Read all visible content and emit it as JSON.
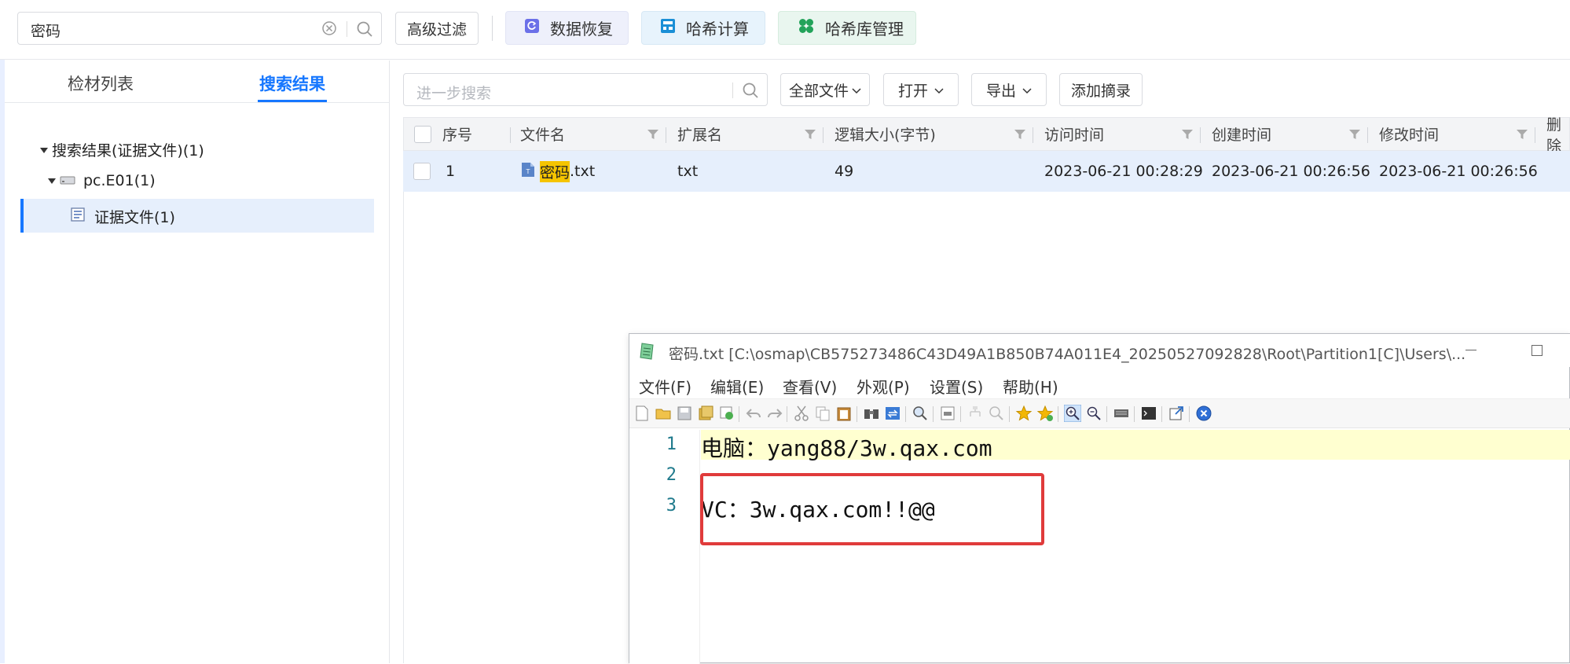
{
  "search": {
    "value": "密码"
  },
  "toolbar": {
    "advanced_filter": "高级过滤",
    "data_recovery": "数据恢复",
    "hash_compute": "哈希计算",
    "hash_library": "哈希库管理"
  },
  "left_panel": {
    "tabs": [
      "检材列表",
      "搜索结果"
    ],
    "active_tab": "搜索结果",
    "tree": {
      "root": "搜索结果(证据文件)(1)",
      "child": "pc.E01(1)",
      "leaf": "证据文件(1)"
    }
  },
  "results": {
    "search_placeholder": "进一步搜索",
    "all_files": "全部文件",
    "open": "打开",
    "export": "导出",
    "add_note": "添加摘录",
    "columns": [
      "序号",
      "文件名",
      "扩展名",
      "逻辑大小(字节)",
      "访问时间",
      "创建时间",
      "修改时间",
      "删除"
    ],
    "rows": [
      {
        "index": "1",
        "name_highlight": "密码",
        "name_rest": ".txt",
        "ext": "txt",
        "size": "49",
        "accessed": "2023-06-21 00:28:29",
        "created": "2023-06-21 00:26:56",
        "modified": "2023-06-21 00:26:56"
      }
    ]
  },
  "editor": {
    "title": "密码.txt [C:\\osmap\\CB575273486C43D49A1B850B74A011E4_20250527092828\\Root\\Partition1[C]\\Users\\...",
    "menu": [
      "文件(F)",
      "编辑(E)",
      "查看(V)",
      "外观(P)",
      "设置(S)",
      "帮助(H)"
    ],
    "line_numbers": [
      "1",
      "2",
      "3"
    ],
    "lines": [
      "电脑：yang88/3w.qax.com",
      "",
      "VC：3w.qax.com!!@@"
    ]
  },
  "colors": {
    "accent": "#1677ff",
    "highlight": "#f5c400",
    "selected_row": "#e6effc",
    "annotation_box": "#e03b3b",
    "current_line": "#ffffd0"
  }
}
